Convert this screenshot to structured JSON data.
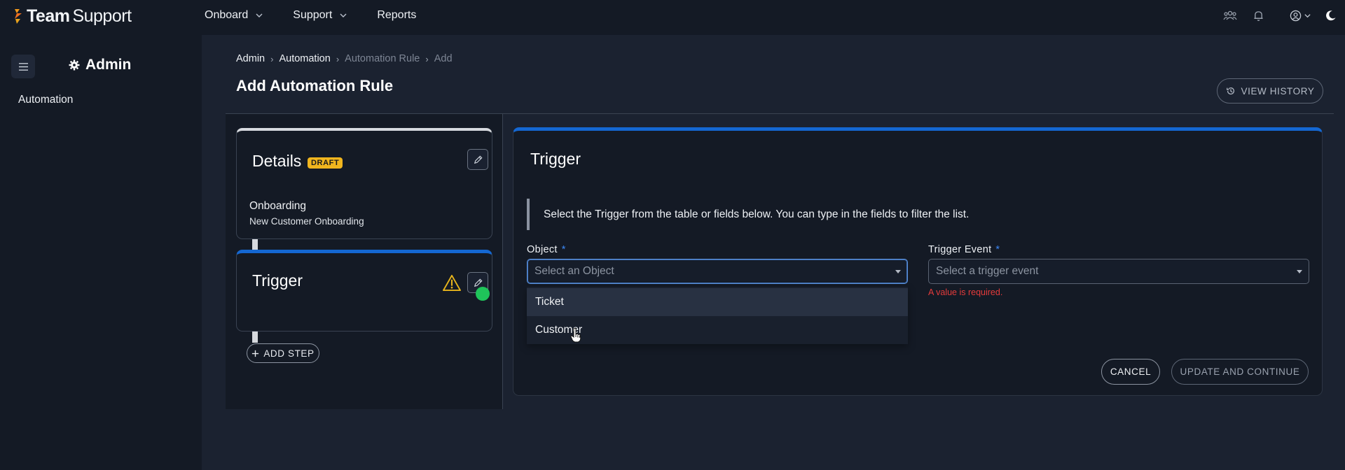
{
  "app": {
    "logo_bold": "Team",
    "logo_light": "Support"
  },
  "topnav": {
    "items": [
      {
        "label": "Onboard",
        "has_dropdown": true
      },
      {
        "label": "Support",
        "has_dropdown": true
      },
      {
        "label": "Reports",
        "has_dropdown": false
      }
    ],
    "icons": [
      "users-icon",
      "bell-icon",
      "account-icon",
      "moon-icon"
    ]
  },
  "sidebar": {
    "title": "Admin",
    "items": [
      {
        "label": "Automation"
      }
    ]
  },
  "breadcrumb": {
    "items": [
      "Admin",
      "Automation",
      "Automation Rule",
      "Add"
    ]
  },
  "page": {
    "title": "Add Automation Rule",
    "view_history_label": "VIEW HISTORY"
  },
  "details_card": {
    "title": "Details",
    "badge": "DRAFT",
    "line1": "Onboarding",
    "line2": "New Customer Onboarding"
  },
  "trigger_card": {
    "title": "Trigger"
  },
  "add_step_label": "ADD STEP",
  "trigger_panel": {
    "title": "Trigger",
    "info": "Select the Trigger from the table or fields below. You can type in the fields to filter the list.",
    "object_label": "Object",
    "object_placeholder": "Select an Object",
    "object_options": [
      "Ticket",
      "Customer"
    ],
    "event_label": "Trigger Event",
    "event_placeholder": "Select a trigger event",
    "event_error": "A value is required.",
    "required_mark": "*",
    "cancel_label": "CANCEL",
    "update_label": "UPDATE AND CONTINUE"
  },
  "colors": {
    "accent_blue": "#1467d2",
    "draft_badge": "#f0b51e",
    "success_green": "#1fc45a",
    "warning_yellow": "#e8b51c",
    "error_red": "#e53b3b"
  }
}
